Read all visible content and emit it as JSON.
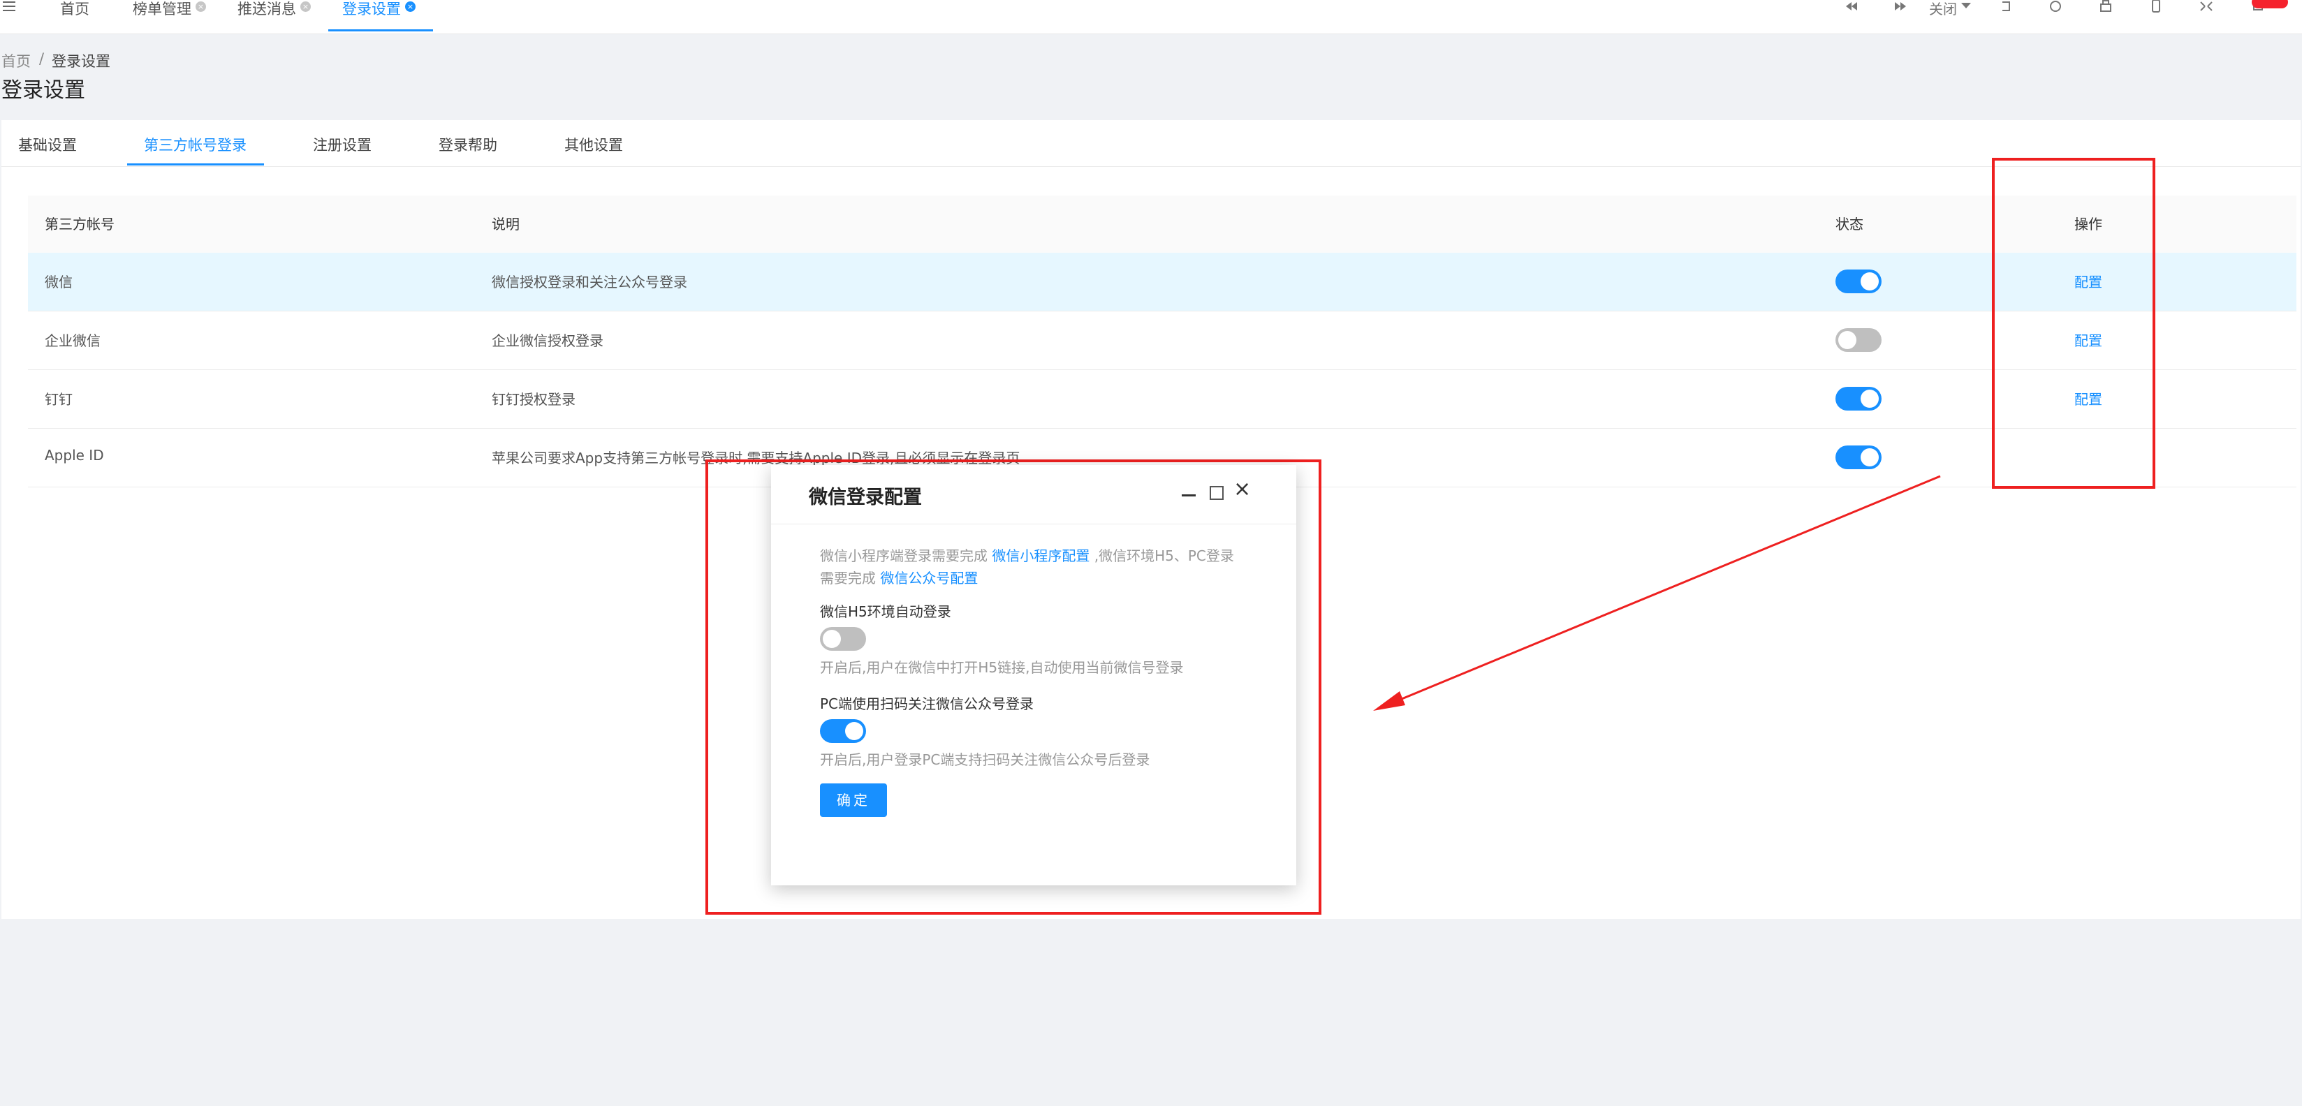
{
  "topbar": {
    "tabs": [
      {
        "label": "首页",
        "closable": false,
        "active": false
      },
      {
        "label": "榜单管理",
        "closable": true,
        "active": false
      },
      {
        "label": "推送消息",
        "closable": true,
        "active": false
      },
      {
        "label": "登录设置",
        "closable": true,
        "active": true
      }
    ],
    "close_label": "关闭",
    "icons": [
      "backward-icon",
      "forward-icon",
      "close-dropdown",
      "undo-icon",
      "refresh-icon",
      "print-icon",
      "mobile-icon",
      "fullscreen-icon",
      "bell-icon"
    ]
  },
  "breadcrumb": {
    "home": "首页",
    "separator": "/",
    "current": "登录设置"
  },
  "page_title": "登录设置",
  "subtabs": [
    "基础设置",
    "第三方帐号登录",
    "注册设置",
    "登录帮助",
    "其他设置"
  ],
  "table": {
    "headers": {
      "account": "第三方帐号",
      "desc": "说明",
      "status": "状态",
      "action": "操作"
    },
    "rows": [
      {
        "account": "微信",
        "desc": "微信授权登录和关注公众号登录",
        "enabled": true,
        "action": "配置"
      },
      {
        "account": "企业微信",
        "desc": "企业微信授权登录",
        "enabled": false,
        "action": "配置"
      },
      {
        "account": "钉钉",
        "desc": "钉钉授权登录",
        "enabled": true,
        "action": "配置"
      },
      {
        "account": "Apple ID",
        "desc": "苹果公司要求App支持第三方帐号登录时,需要支持Apple ID登录,且必须显示在登录页",
        "enabled": true,
        "action": ""
      }
    ]
  },
  "dialog": {
    "title": "微信登录配置",
    "hint_prefix": "微信小程序端登录需要完成",
    "hint_link1": "微信小程序配置",
    "hint_mid": ",微信环境H5、PC登录",
    "hint_line2_prefix": "需要完成",
    "hint_link2": "微信公众号配置",
    "h5_label": "微信H5环境自动登录",
    "h5_enabled": false,
    "h5_desc": "开启后,用户在微信中打开H5链接,自动使用当前微信号登录",
    "pc_label": "PC端使用扫码关注微信公众号登录",
    "pc_enabled": true,
    "pc_desc": "开启后,用户登录PC端支持扫码关注微信公众号后登录",
    "ok_label": "确定"
  },
  "colors": {
    "accent": "#1890ff",
    "annotation": "#ee2020",
    "switch_off": "#bfbfbf",
    "row_highlight": "#e6f7ff"
  }
}
